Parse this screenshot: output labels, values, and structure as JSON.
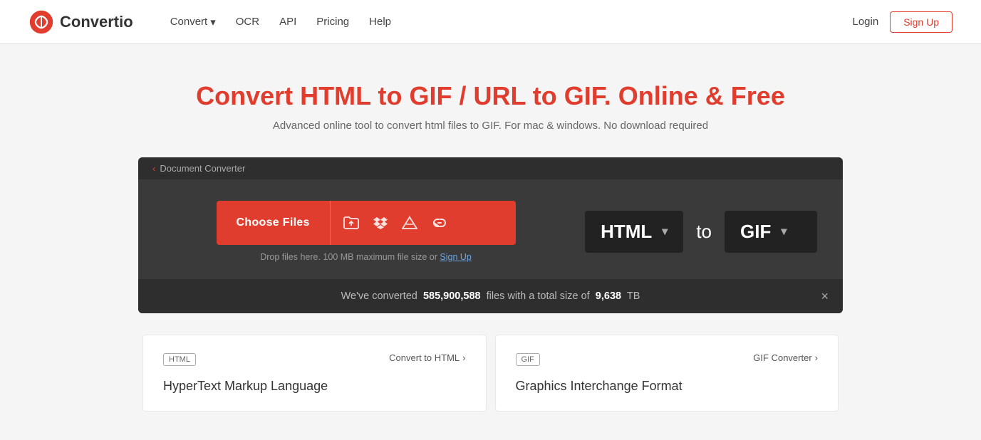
{
  "brand": {
    "name": "Convertio"
  },
  "nav": {
    "convert_label": "Convert",
    "ocr_label": "OCR",
    "api_label": "API",
    "pricing_label": "Pricing",
    "help_label": "Help",
    "login_label": "Login",
    "signup_label": "Sign Up"
  },
  "hero": {
    "title": "Convert HTML to GIF / URL to GIF. Online & Free",
    "subtitle": "Advanced online tool to convert html files to GIF. For mac & windows. No download required"
  },
  "converter": {
    "breadcrumb_label": "Document Converter",
    "chevron": "‹",
    "choose_files_label": "Choose Files",
    "drop_hint": "Drop files here. 100 MB maximum file size or",
    "sign_up_hint": "Sign Up",
    "from_format": "HTML",
    "to_label": "to",
    "to_format": "GIF"
  },
  "stats": {
    "prefix": "We've converted",
    "files_count": "585,900,588",
    "middle": "files with a total size of",
    "size": "9,638",
    "suffix": "TB"
  },
  "cards": [
    {
      "tag": "HTML",
      "link_label": "Convert to HTML",
      "title": "HyperText Markup Language"
    },
    {
      "tag": "GIF",
      "link_label": "GIF Converter",
      "title": "Graphics Interchange Format"
    }
  ],
  "icons": {
    "folder_icon": "📁",
    "dropbox_icon": "⬛",
    "gdrive_icon": "🔺",
    "link_icon": "🔗",
    "caret_down": "▾",
    "close_icon": "×",
    "chevron_right": "›"
  }
}
